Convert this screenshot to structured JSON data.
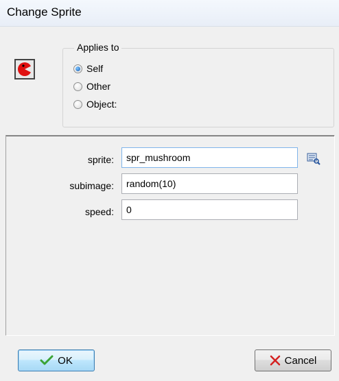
{
  "window": {
    "title": "Change Sprite"
  },
  "action_icon": "sprite-action-icon",
  "applies_to": {
    "legend": "Applies to",
    "options": [
      {
        "label": "Self",
        "checked": true
      },
      {
        "label": "Other",
        "checked": false
      },
      {
        "label": "Object:",
        "checked": false
      }
    ]
  },
  "params": {
    "sprite": {
      "label": "sprite:",
      "value": "spr_mushroom"
    },
    "subimage": {
      "label": "subimage:",
      "value": "random(10)"
    },
    "speed": {
      "label": "speed:",
      "value": "0"
    }
  },
  "buttons": {
    "ok": "OK",
    "cancel": "Cancel"
  },
  "colors": {
    "ok_check": "#3aa335",
    "cancel_x": "#d42020",
    "icon_red": "#e01010"
  }
}
